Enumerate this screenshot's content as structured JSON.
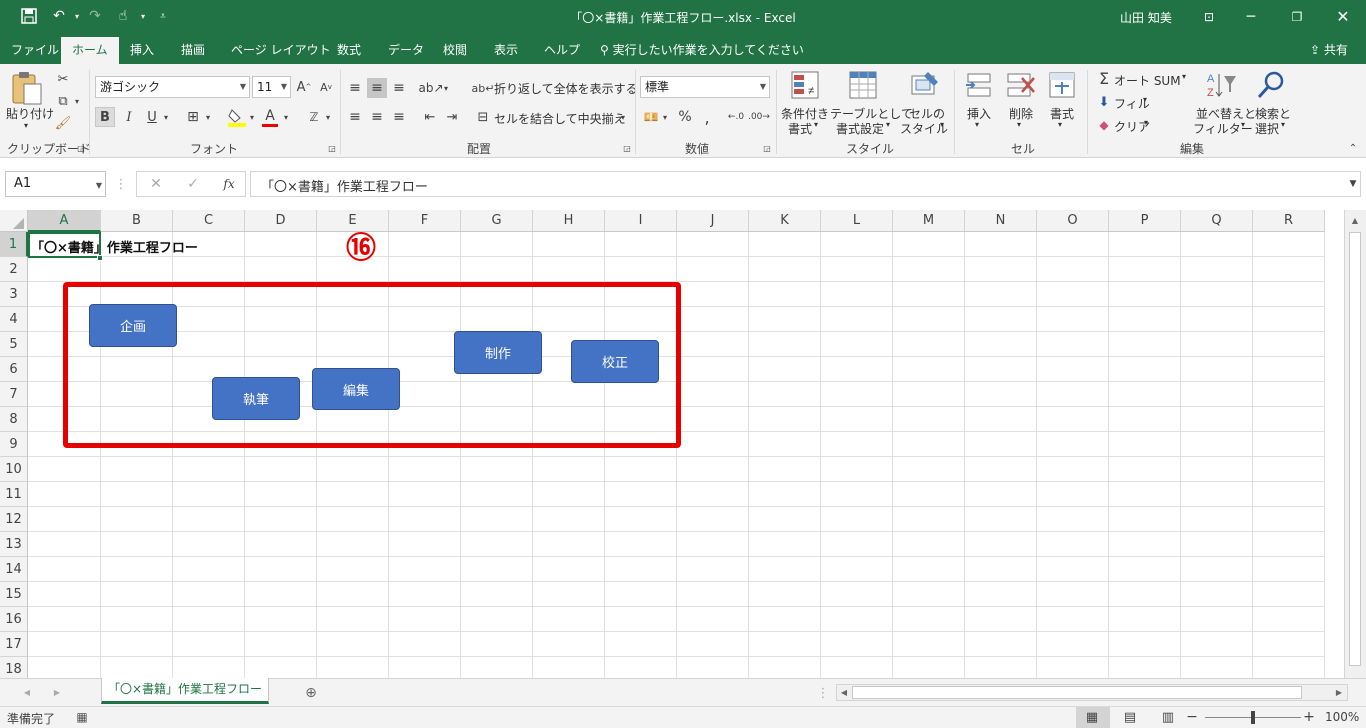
{
  "window": {
    "title": "「〇×書籍」作業工程フロー.xlsx  -  Excel",
    "user": "山田 知美",
    "share": "共有"
  },
  "tabs": [
    "ファイル",
    "ホーム",
    "挿入",
    "描画",
    "ページ レイアウト",
    "数式",
    "データ",
    "校閲",
    "表示",
    "ヘルプ"
  ],
  "tell_me": "実行したい作業を入力してください",
  "ribbon": {
    "clipboard": {
      "paste": "貼り付け",
      "group": "クリップボード"
    },
    "font": {
      "name": "游ゴシック",
      "size": "11",
      "bold": "B",
      "italic": "I",
      "underline": "U",
      "font_color": "A",
      "group": "フォント"
    },
    "alignment": {
      "wrap": "折り返して全体を表示する",
      "merge": "セルを結合して中央揃え",
      "group": "配置"
    },
    "number": {
      "format": "標準",
      "percent": "%",
      "group": "数値"
    },
    "styles": {
      "conditional": "条件付き",
      "conditional2": "書式",
      "table": "テーブルとして",
      "table2": "書式設定",
      "cell": "セルの",
      "cell2": "スタイル",
      "group": "スタイル"
    },
    "cells": {
      "insert": "挿入",
      "delete": "削除",
      "format": "書式",
      "group": "セル"
    },
    "editing": {
      "autosum": "オート SUM",
      "fill": "フィル",
      "clear": "クリア",
      "sort": "並べ替えと",
      "sort2": "フィルター",
      "find": "検索と",
      "find2": "選択",
      "group": "編集"
    }
  },
  "formula_bar": {
    "name_box": "A1",
    "fx": "fx",
    "content": "「〇×書籍」作業工程フロー"
  },
  "columns": [
    "A",
    "B",
    "C",
    "D",
    "E",
    "F",
    "G",
    "H",
    "I",
    "J",
    "K",
    "L",
    "M",
    "N",
    "O",
    "P",
    "Q",
    "R"
  ],
  "rows": [
    "1",
    "2",
    "3",
    "4",
    "5",
    "6",
    "7",
    "8",
    "9",
    "10",
    "11",
    "12",
    "13",
    "14",
    "15",
    "16",
    "17",
    "18"
  ],
  "cell_a1": "「〇×書籍」作業工程フロー",
  "badge": "⑯",
  "shapes": {
    "plan": "企画",
    "write": "執筆",
    "edit": "編集",
    "produce": "制作",
    "proof": "校正"
  },
  "sheet_tab": "「〇×書籍」作業工程フロー",
  "status": {
    "ready": "準備完了",
    "zoom": "100%"
  },
  "colors": {
    "excel_green": "#217346",
    "shape_fill": "#4472c4",
    "highlight": "#e60000"
  }
}
